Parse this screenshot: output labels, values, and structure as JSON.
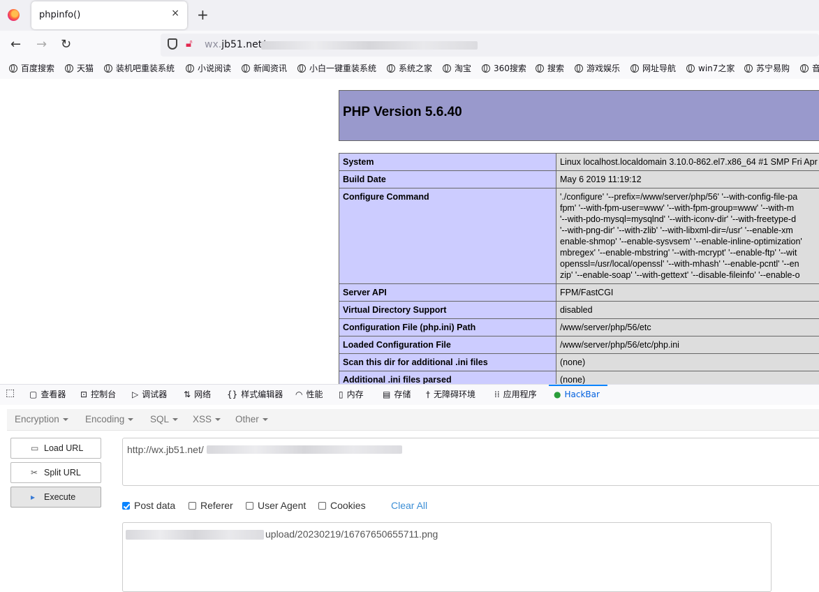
{
  "browser": {
    "tab_title": "phpinfo()",
    "tab_close": "×",
    "new_tab": "+",
    "url_host_prefix": "wx.",
    "url_host": "jb51.net/",
    "back": "←",
    "forward": "→",
    "reload": "↻"
  },
  "bookmarks": [
    "百度搜索",
    "天猫",
    "装机吧重装系统",
    "小说阅读",
    "新闻资讯",
    "小白一键重装系统",
    "系统之家",
    "淘宝",
    "360搜索",
    "搜索",
    "游戏娱乐",
    "网址导航",
    "win7之家",
    "苏宁易购",
    "音"
  ],
  "phpinfo": {
    "version_title": "PHP Version 5.6.40",
    "rows": [
      {
        "key": "System",
        "lines": [
          "Linux localhost.localdomain 3.10.0-862.el7.x86_64 #1 SMP Fri Apr"
        ]
      },
      {
        "key": "Build Date",
        "lines": [
          "May 6 2019 11:19:12"
        ]
      },
      {
        "key": "Configure Command",
        "lines": [
          "'./configure' '--prefix=/www/server/php/56' '--with-config-file-pa",
          "fpm' '--with-fpm-user=www' '--with-fpm-group=www' '--with-m",
          "'--with-pdo-mysql=mysqlnd' '--with-iconv-dir' '--with-freetype-d",
          "'--with-png-dir' '--with-zlib' '--with-libxml-dir=/usr' '--enable-xm",
          "enable-shmop' '--enable-sysvsem' '--enable-inline-optimization'",
          "mbregex' '--enable-mbstring' '--with-mcrypt' '--enable-ftp' '--wit",
          "openssl=/usr/local/openssl' '--with-mhash' '--enable-pcntl' '--en",
          "zip' '--enable-soap' '--with-gettext' '--disable-fileinfo' '--enable-o"
        ]
      },
      {
        "key": "Server API",
        "lines": [
          "FPM/FastCGI"
        ]
      },
      {
        "key": "Virtual Directory Support",
        "lines": [
          "disabled"
        ]
      },
      {
        "key": "Configuration File (php.ini) Path",
        "lines": [
          "/www/server/php/56/etc"
        ]
      },
      {
        "key": "Loaded Configuration File",
        "lines": [
          "/www/server/php/56/etc/php.ini"
        ]
      },
      {
        "key": "Scan this dir for additional .ini files",
        "lines": [
          "(none)"
        ]
      },
      {
        "key": "Additional .ini files parsed",
        "lines": [
          "(none)"
        ]
      }
    ]
  },
  "devtools": {
    "tabs": [
      "查看器",
      "控制台",
      "调试器",
      "网络",
      "样式编辑器",
      "性能",
      "内存",
      "存储",
      "无障碍环境",
      "应用程序",
      "HackBar"
    ],
    "icons": [
      "inspector-icon",
      "console-icon",
      "debugger-icon",
      "network-icon",
      "style-editor-icon",
      "performance-icon",
      "memory-icon",
      "storage-icon",
      "accessibility-icon",
      "application-icon",
      "hackbar-icon"
    ]
  },
  "hackbar": {
    "menus": [
      "Encryption",
      "Encoding",
      "SQL",
      "XSS",
      "Other"
    ],
    "load_url": "Load URL",
    "split_url": "Split URL",
    "execute": "Execute",
    "url_value": "http://wx.jb51.net/",
    "checkboxes": [
      {
        "label": "Post data",
        "checked": true
      },
      {
        "label": "Referer",
        "checked": false
      },
      {
        "label": "User Agent",
        "checked": false
      },
      {
        "label": "Cookies",
        "checked": false
      }
    ],
    "clear_all": "Clear All",
    "post_value": "upload/20230219/16767650655711.png"
  }
}
